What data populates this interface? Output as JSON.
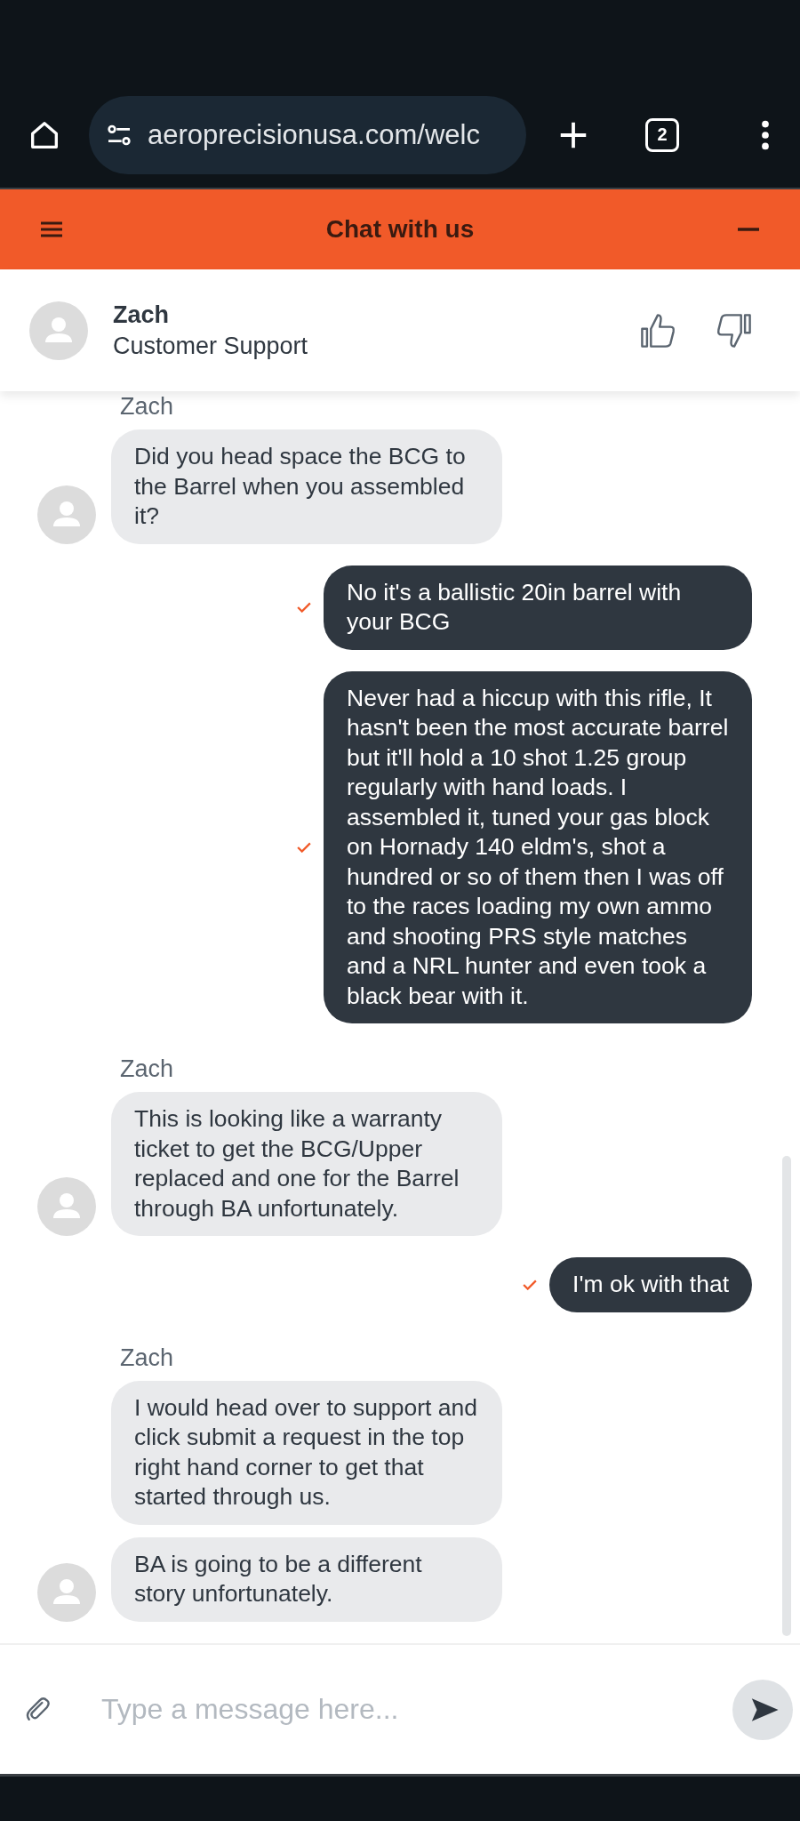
{
  "browser": {
    "url": "aeroprecisionusa.com/welc",
    "tab_count": "2"
  },
  "chat": {
    "title": "Chat with us"
  },
  "agent": {
    "name": "Zach",
    "role": "Customer Support"
  },
  "messages": [
    {
      "kind": "name",
      "text": "Zach"
    },
    {
      "kind": "incoming",
      "text": "Did you head space the BCG to the Barrel when you assembled it?",
      "avatar": true
    },
    {
      "kind": "outgoing",
      "text": "No it's a ballistic 20in barrel with your BCG",
      "delivered": true
    },
    {
      "kind": "outgoing",
      "text": "Never had a hiccup with this rifle, It hasn't been the most accurate barrel but it'll hold a 10 shot 1.25 group regularly with hand loads. I assembled it, tuned your gas block on Hornady 140 eldm's, shot a hundred or so of them then I was off to the races loading my own ammo and shooting PRS style matches and a NRL hunter and even took a black bear with it.",
      "delivered": true
    },
    {
      "kind": "name",
      "text": "Zach"
    },
    {
      "kind": "incoming",
      "text": "This is looking like a warranty ticket to get the BCG/Upper replaced and one for the Barrel through BA unfortunately.",
      "avatar": true
    },
    {
      "kind": "outgoing",
      "text": "I'm ok with that",
      "delivered": true
    },
    {
      "kind": "name",
      "text": "Zach"
    },
    {
      "kind": "incoming",
      "text": "I would head over to support and click submit a request in the top right hand corner to get that started through us.",
      "avatar": false
    },
    {
      "kind": "incoming",
      "text": "BA is going to be a different story unfortunately.",
      "avatar": true
    }
  ],
  "composer": {
    "placeholder": "Type a message here..."
  }
}
